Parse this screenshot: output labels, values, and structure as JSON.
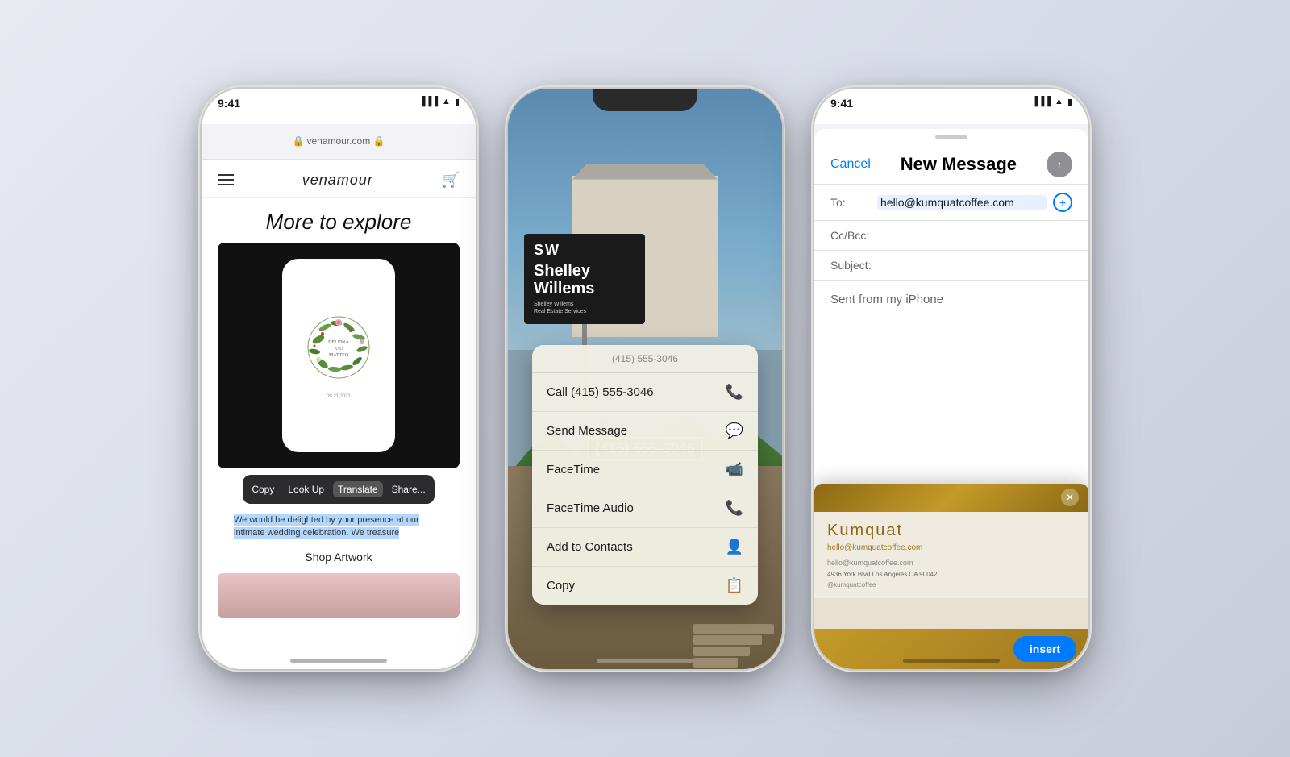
{
  "phone1": {
    "status": {
      "time": "9:41",
      "icons": "▐▐▐ ▲ ▮"
    },
    "browser": {
      "url": "venamour.com 🔒"
    },
    "site": {
      "logo": "venamour",
      "explore_title": "More to explore",
      "invitation": {
        "couple": "DELFINA\nAND\nMATTEO",
        "date": "09.21.2021"
      },
      "shop_label": "Shop Artwork"
    },
    "context_menu": {
      "copy": "Copy",
      "look_up": "Look Up",
      "translate": "Translate",
      "share": "Share..."
    },
    "selected_text": "We would be delighted by your presence at our intimate wedding celebration. We treasure"
  },
  "phone2": {
    "sign": {
      "initials": "SW",
      "name": "Shelley\nWillems",
      "subtitle": "Shelley Willems\nReal Estate Services"
    },
    "phone_number": "(415) 555-3046",
    "popup": {
      "header": "(415) 555-3046",
      "items": [
        {
          "label": "Call (415) 555-3046",
          "icon": "📞"
        },
        {
          "label": "Send Message",
          "icon": "💬"
        },
        {
          "label": "FaceTime",
          "icon": "📷"
        },
        {
          "label": "FaceTime Audio",
          "icon": "📞"
        },
        {
          "label": "Add to Contacts",
          "icon": "👤"
        },
        {
          "label": "Copy",
          "icon": "📋"
        }
      ]
    }
  },
  "phone3": {
    "status": {
      "time": "9:41"
    },
    "mail": {
      "cancel": "Cancel",
      "title": "New Message",
      "to_label": "To:",
      "to_value": "hello@kumquatcoffee.com",
      "cc_label": "Cc/Bcc:",
      "subject_label": "Subject:",
      "body": "Sent from my iPhone"
    },
    "card": {
      "brand": "Kumquat",
      "email_primary": "hello@kumquatcoffee.com",
      "email_secondary": "hello@kumquatcoffee.com",
      "address": "4936 York Blvd Los Angeles CA 90042",
      "handle": "@kumquatcoffee",
      "insert_btn": "insert"
    }
  }
}
